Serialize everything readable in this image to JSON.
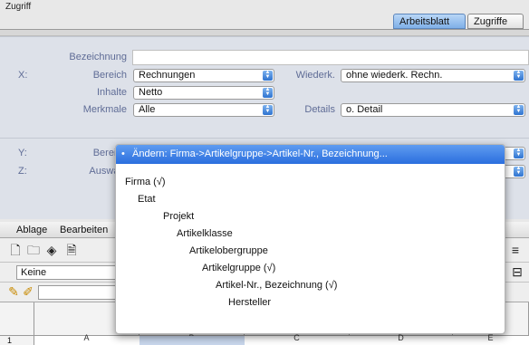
{
  "window": {
    "title_fragment": "Zugriff"
  },
  "tabs": [
    {
      "label": "Arbeitsblatt",
      "active": true
    },
    {
      "label": "Zugriffe",
      "active": false
    }
  ],
  "form": {
    "bezeichnung_label": "Bezeichnung",
    "x": {
      "axis_label": "X:",
      "bereich_label": "Bereich",
      "bereich_value": "Rechnungen",
      "wiederk_label": "Wiederk.",
      "wiederk_value": "ohne wiederk. Rechn.",
      "inhalte_label": "Inhalte",
      "inhalte_value": "Netto",
      "merkmale_label": "Merkmale",
      "merkmale_value": "Alle",
      "details_label": "Details",
      "details_value": "o. Detail"
    },
    "y": {
      "axis_label": "Y:",
      "bereich_label": "Bereich"
    },
    "z": {
      "axis_label": "Z:",
      "auswahl_label": "Auswahl"
    }
  },
  "menubar": {
    "items": [
      "Ablage",
      "Bearbeiten"
    ]
  },
  "fontbox": {
    "value": "Keine"
  },
  "spreadsheet": {
    "columns": [
      "A",
      "B",
      "C",
      "D",
      "E"
    ],
    "rows": [
      "1"
    ]
  },
  "popup": {
    "selected": "Ändern: Firma->Artikelgruppe->Artikel-Nr., Bezeichnung...",
    "bullet": "•",
    "items": [
      "Firma (√)",
      "Etat",
      "Projekt",
      "Artikelklasse",
      "Artikelobergruppe",
      "Artikelgruppe (√)",
      "Artikel-Nr., Bezeichnung (√)",
      "Hersteller"
    ]
  },
  "icons": {
    "spin": "up-down-arrows-icon",
    "align_right": "align-right-icon",
    "table": "table-icon"
  }
}
